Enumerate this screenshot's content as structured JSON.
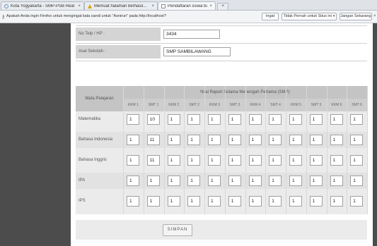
{
  "browser": {
    "tabs": [
      {
        "title": "Kota Yogyakarta - SMP-PSB Real Ti...",
        "icon": "globe-icon"
      },
      {
        "title": "Memuat halaman berhasil...",
        "icon": "warning-icon"
      },
      {
        "title": "Pendaftaran siswa baru",
        "icon": "page-icon"
      }
    ],
    "new_tab_label": "+"
  },
  "notification": {
    "text": "Apakah Anda ingin Firefox untuk mengingat kata sandi untuk \"Asnirun\" pada http://localhost?",
    "buttons": {
      "remember": "Ingat",
      "never": "Tidak Pernah untuk Situs ini",
      "not_now": "Jangan Sekarang"
    },
    "close": "×"
  },
  "form": {
    "phone_label": "No Telp / HP :",
    "phone_value": "3434",
    "school_label": "Asal Sekolah :",
    "school_value": "SMP SAMBILAWANG"
  },
  "grades": {
    "subject_header": "Mata Pelajaran",
    "main_header": "Nilai Raport Selama Menengah Pertama (SMP)",
    "columns": [
      "KKM 1",
      "SMT 1",
      "KKM 2",
      "SMT 2",
      "KKM 3",
      "SMT 3",
      "KKM 4",
      "SMT 4",
      "KKM 5",
      "SMT 5",
      "KKM 6",
      "SMT 6"
    ],
    "rows": [
      {
        "subject": "Matematika",
        "values": [
          "1",
          "10",
          "1",
          "1",
          "1",
          "1",
          "1",
          "1",
          "1",
          "1",
          "1",
          "1"
        ]
      },
      {
        "subject": "Bahasa Indonesia",
        "values": [
          "1",
          "11",
          "1",
          "1",
          "1",
          "1",
          "1",
          "1",
          "1",
          "1",
          "1",
          "1"
        ]
      },
      {
        "subject": "Bahasa Inggris",
        "values": [
          "1",
          "11",
          "1",
          "1",
          "1",
          "1",
          "1",
          "1",
          "1",
          "1",
          "1",
          "1"
        ]
      },
      {
        "subject": "IPA",
        "values": [
          "1",
          "1",
          "1",
          "1",
          "1",
          "1",
          "1",
          "1",
          "1",
          "1",
          "1",
          "1"
        ]
      },
      {
        "subject": "IPS",
        "values": [
          "1",
          "1",
          "1",
          "1",
          "1",
          "1",
          "1",
          "1",
          "1",
          "1",
          "1",
          "1"
        ]
      }
    ]
  },
  "save_label": "SIMPAN",
  "colors": {
    "sidebar": "#4c4c4c",
    "header_bg": "#c4c4c4",
    "label_bg": "#d4d4d4",
    "table_bg": "#ebebeb"
  }
}
